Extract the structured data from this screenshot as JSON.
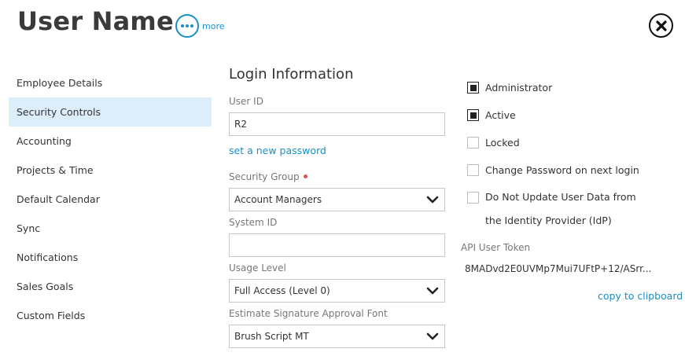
{
  "header": {
    "title": "User Name",
    "more_label": "more"
  },
  "sidebar": {
    "items": [
      {
        "label": "Employee Details"
      },
      {
        "label": "Security Controls",
        "active": true
      },
      {
        "label": "Accounting"
      },
      {
        "label": "Projects & Time"
      },
      {
        "label": "Default Calendar"
      },
      {
        "label": "Sync"
      },
      {
        "label": "Notifications"
      },
      {
        "label": "Sales Goals"
      },
      {
        "label": "Custom Fields"
      }
    ]
  },
  "login": {
    "title": "Login Information",
    "user_id_label": "User ID",
    "user_id_value": "R2",
    "set_password_link": "set a new password",
    "security_group_label": "Security Group",
    "security_group_value": "Account Managers",
    "system_id_label": "System ID",
    "system_id_value": "",
    "usage_level_label": "Usage Level",
    "usage_level_value": "Full Access (Level 0)",
    "signature_font_label": "Estimate Signature Approval Font",
    "signature_font_value": "Brush Script MT"
  },
  "flags": {
    "administrator": {
      "label": "Administrator",
      "checked": true
    },
    "active": {
      "label": "Active",
      "checked": true
    },
    "locked": {
      "label": "Locked",
      "checked": false
    },
    "change_password": {
      "label": "Change Password on next login",
      "checked": false
    },
    "no_update_idp": {
      "label": "Do Not Update User Data from the Identity Provider (IdP)",
      "checked": false
    }
  },
  "api": {
    "label": "API User Token",
    "token": "8MADvd2E0UVMp7Mui7UFtP+12/ASrr...",
    "copy_link": "copy to clipboard"
  },
  "colors": {
    "accent": "#1a8fc9",
    "active_bg": "#dceefa",
    "required": "#d9534f"
  }
}
